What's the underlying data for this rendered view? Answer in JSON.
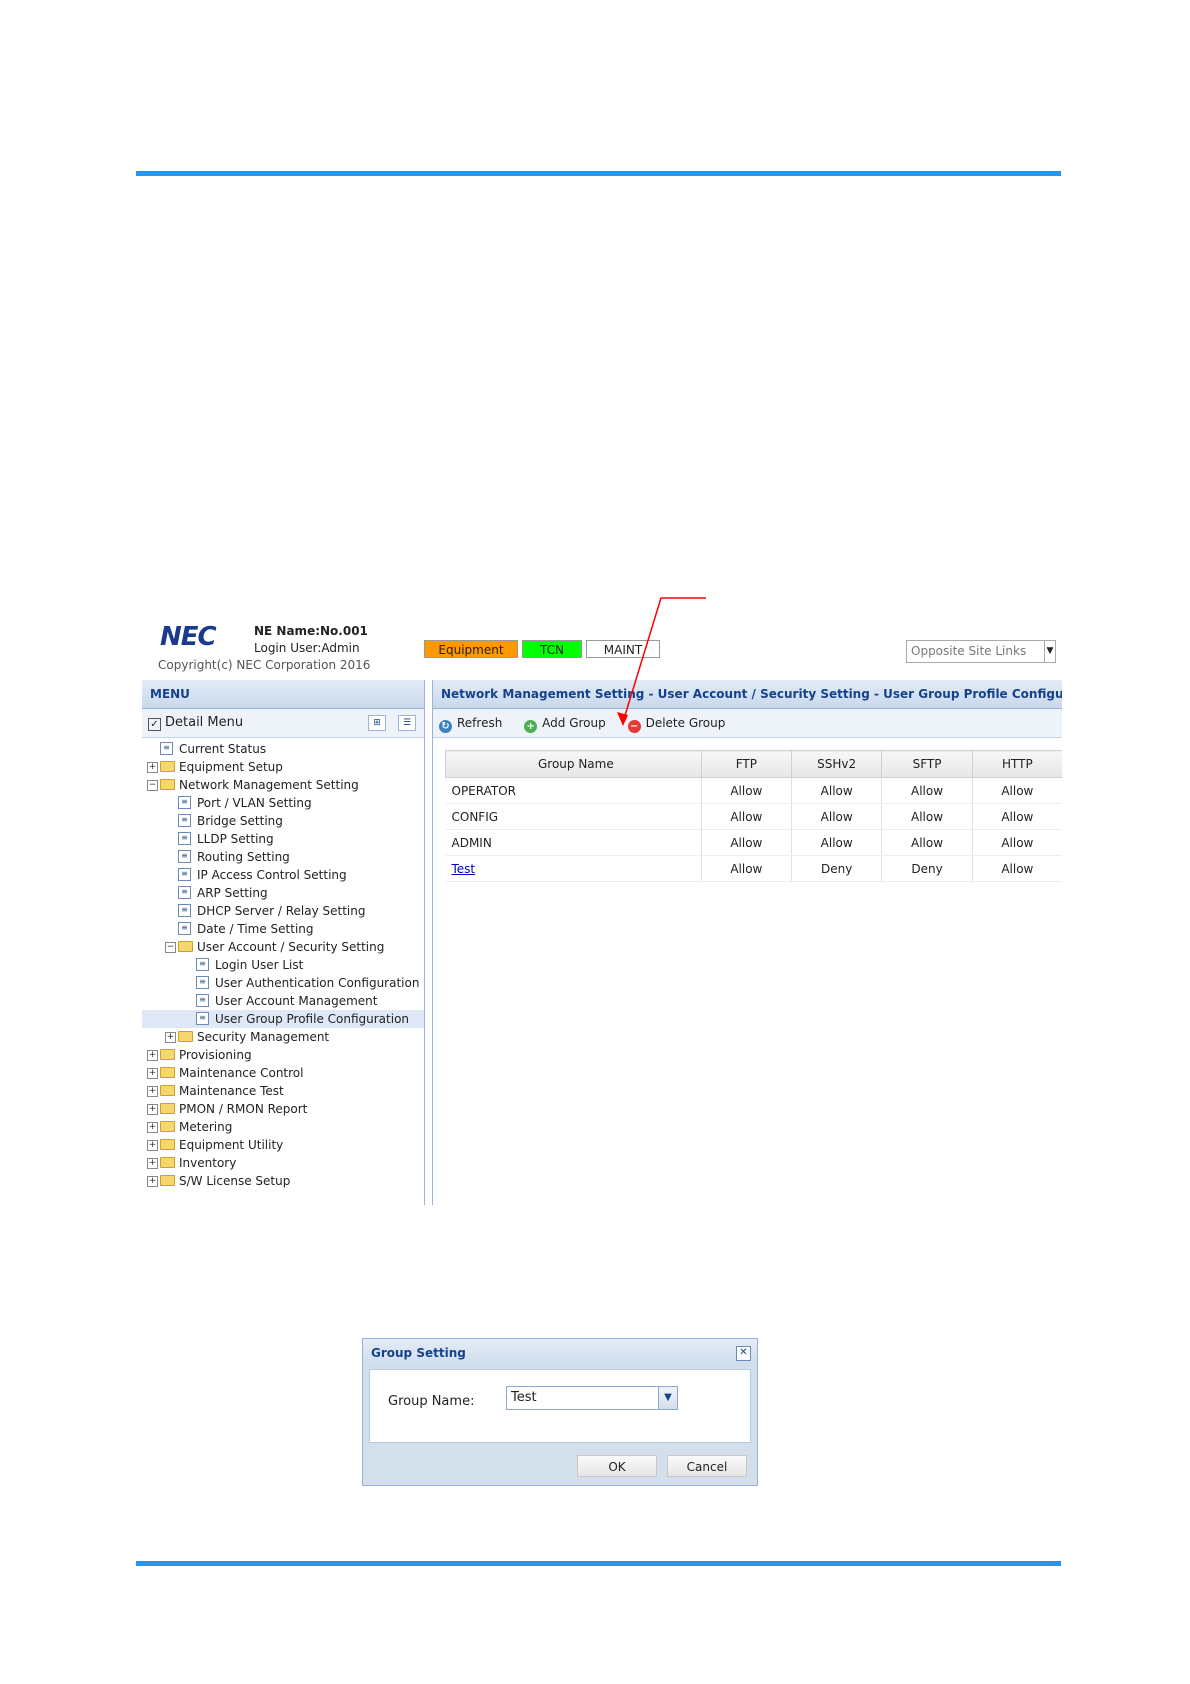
{
  "header": {
    "logo": "NEC",
    "ne_name": "NE Name:No.001",
    "login_user": "Login User:Admin",
    "copyright": "Copyright(c) NEC Corporation 2016",
    "status": [
      {
        "label": "Equipment",
        "color": "#ff9900"
      },
      {
        "label": "TCN",
        "color": "#00ff00"
      },
      {
        "label": "MAINT",
        "color": "#ffffff"
      }
    ],
    "opposite_links_placeholder": "Opposite Site Links"
  },
  "menu": {
    "title": "MENU",
    "detail_menu": "Detail Menu",
    "items": [
      {
        "label": "Current Status"
      },
      {
        "label": "Equipment Setup"
      },
      {
        "label": "Network Management Setting"
      },
      {
        "label": "Port / VLAN Setting"
      },
      {
        "label": "Bridge Setting"
      },
      {
        "label": "LLDP Setting"
      },
      {
        "label": "Routing Setting"
      },
      {
        "label": "IP Access Control Setting"
      },
      {
        "label": "ARP Setting"
      },
      {
        "label": "DHCP Server / Relay Setting"
      },
      {
        "label": "Date / Time Setting"
      },
      {
        "label": "User Account / Security Setting"
      },
      {
        "label": "Login User List"
      },
      {
        "label": "User Authentication Configuration"
      },
      {
        "label": "User Account Management"
      },
      {
        "label": "User Group Profile Configuration"
      },
      {
        "label": "Security Management"
      },
      {
        "label": "Provisioning"
      },
      {
        "label": "Maintenance Control"
      },
      {
        "label": "Maintenance Test"
      },
      {
        "label": "PMON / RMON Report"
      },
      {
        "label": "Metering"
      },
      {
        "label": "Equipment Utility"
      },
      {
        "label": "Inventory"
      },
      {
        "label": "S/W License Setup"
      }
    ]
  },
  "main": {
    "breadcrumb": "Network Management Setting - User Account / Security Setting - User Group Profile Configuration",
    "toolbar": {
      "refresh": "Refresh",
      "add_group": "Add Group",
      "delete_group": "Delete Group"
    },
    "columns": [
      "Group Name",
      "FTP",
      "SSHv2",
      "SFTP",
      "HTTP"
    ],
    "rows": [
      [
        "OPERATOR",
        "Allow",
        "Allow",
        "Allow",
        "Allow"
      ],
      [
        "CONFIG",
        "Allow",
        "Allow",
        "Allow",
        "Allow"
      ],
      [
        "ADMIN",
        "Allow",
        "Allow",
        "Allow",
        "Allow"
      ],
      [
        "Test",
        "Allow",
        "Deny",
        "Deny",
        "Allow"
      ]
    ]
  },
  "dialog": {
    "title": "Group Setting",
    "group_name_label": "Group Name:",
    "group_name_value": "Test",
    "ok": "OK",
    "cancel": "Cancel"
  },
  "colors": {
    "accent_rule": "#2196f3",
    "annotation_arrow": "#ff0000",
    "header_text": "#15428b"
  }
}
